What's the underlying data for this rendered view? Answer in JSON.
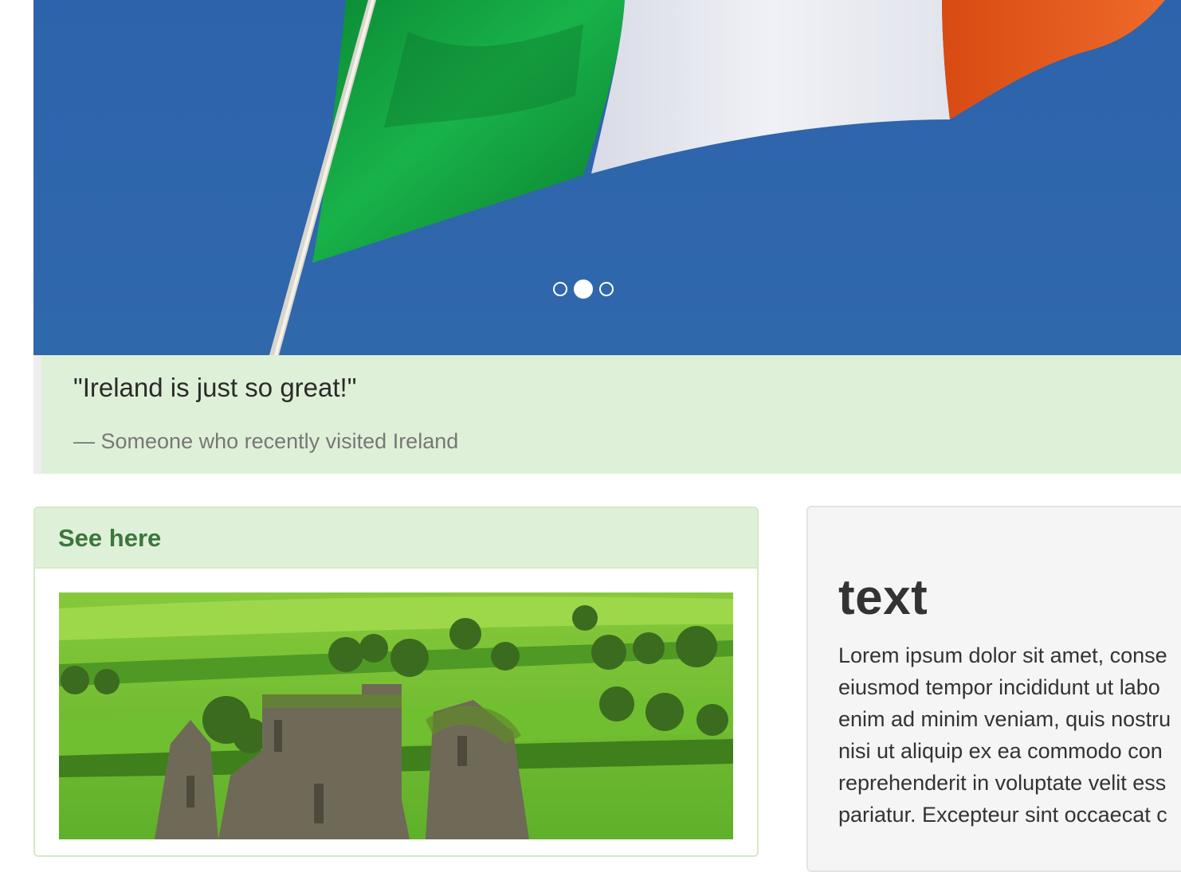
{
  "carousel": {
    "image": "ireland-flag-photo",
    "indicators": [
      {
        "label": "slide-1",
        "active": false
      },
      {
        "label": "slide-2",
        "active": true
      },
      {
        "label": "slide-3",
        "active": false
      }
    ]
  },
  "quote": {
    "text": "\"Ireland is just so great!\"",
    "footer": "— Someone who recently visited Ireland"
  },
  "panel": {
    "title": "See here",
    "image": "ireland-abbey-landscape-photo"
  },
  "well": {
    "heading": "text",
    "lines": [
      "Lorem ipsum dolor sit amet, conse",
      "eiusmod tempor incididunt ut labo",
      "enim ad minim veniam, quis nostru",
      "nisi ut aliquip ex ea commodo con",
      "reprehenderit in voluptate velit ess",
      "pariatur. Excepteur sint occaecat c"
    ]
  },
  "colors": {
    "sky": "#2f66ad",
    "flag_green": "#0e9a3b",
    "flag_white": "#e4e6ee",
    "flag_orange": "#e0561c",
    "success_bg": "#dff0d8",
    "success_text": "#3c763d",
    "well_bg": "#f5f5f5"
  }
}
